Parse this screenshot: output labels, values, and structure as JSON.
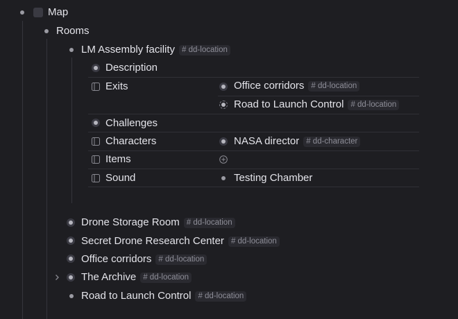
{
  "tree": {
    "root": {
      "label": "Map"
    },
    "rooms": {
      "label": "Rooms"
    },
    "lm": {
      "label": "LM Assembly facility",
      "tag": "# dd-location",
      "properties": {
        "description": "Description",
        "exits": "Exits",
        "exit_values": [
          {
            "label": "Office corridors",
            "tag": "# dd-location"
          },
          {
            "label": "Road to Launch Control",
            "tag": "# dd-location"
          }
        ],
        "challenges": "Challenges",
        "characters": "Characters",
        "character_value": {
          "label": "NASA director",
          "tag": "# dd-character"
        },
        "items": "Items",
        "sound": "Sound",
        "sound_value": "Testing Chamber"
      }
    },
    "children": [
      {
        "label": "Drone Storage Room",
        "tag": "# dd-location"
      },
      {
        "label": "Secret Drone Research Center",
        "tag": "# dd-location"
      },
      {
        "label": "Office corridors",
        "tag": "# dd-location"
      },
      {
        "label": "The Archive",
        "tag": "# dd-location"
      },
      {
        "label": "Road to Launch Control",
        "tag": "# dd-location"
      }
    ]
  },
  "icons": {
    "property": "panel-icon",
    "add": "plus-circle-icon",
    "expand": "chevron-right-icon"
  },
  "colors": {
    "background": "#1e1e22",
    "text": "#e4e4ea",
    "tag_text": "#8e8e98",
    "tag_bg": "#2a2a30"
  }
}
